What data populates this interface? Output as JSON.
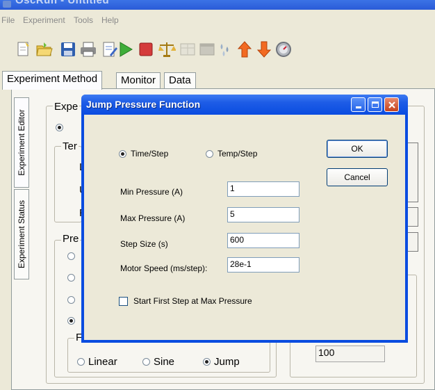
{
  "window": {
    "title": "OscRun - Untitled"
  },
  "menu": {
    "items": [
      "File",
      "Experiment",
      "Tools",
      "Help"
    ]
  },
  "toolbar": {
    "icons": [
      "new-document-icon",
      "open-folder-icon",
      "save-icon",
      "print-icon",
      "edit-icon",
      "play-icon",
      "stop-icon",
      "balance-icon",
      "grid-disabled-icon",
      "panel-disabled-icon",
      "drops-icon",
      "up-arrow-icon",
      "down-arrow-icon",
      "gauge-icon"
    ]
  },
  "main_tabs": [
    "Experiment Method",
    "Monitor",
    "Data"
  ],
  "side_tabs": [
    "Experiment Editor",
    "Experiment Status"
  ],
  "editor": {
    "group1_label": "Expe",
    "group2_label": "Ter",
    "row_l": "L",
    "row_u": "U",
    "row_r": "R",
    "group3_label": "Pre",
    "group4_label": "F",
    "waveform": {
      "linear": "Linear",
      "sine": "Sine",
      "jump": "Jump",
      "selected": "Jump"
    },
    "right_value": "100"
  },
  "dialog": {
    "title": "Jump Pressure Function",
    "mode_time": "Time/Step",
    "mode_temp": "Temp/Step",
    "mode_selected": "Time/Step",
    "ok": "OK",
    "cancel": "Cancel",
    "fields": {
      "min_pressure_label": "Min Pressure (A)",
      "min_pressure_value": "1",
      "max_pressure_label": "Max Pressure (A)",
      "max_pressure_value": "5",
      "step_size_label": "Step Size (s)",
      "step_size_value": "600",
      "motor_speed_label": "Motor Speed (ms/step):",
      "motor_speed_value": "28e-1"
    },
    "start_first_label": "Start First Step at Max Pressure",
    "start_first_checked": false
  }
}
